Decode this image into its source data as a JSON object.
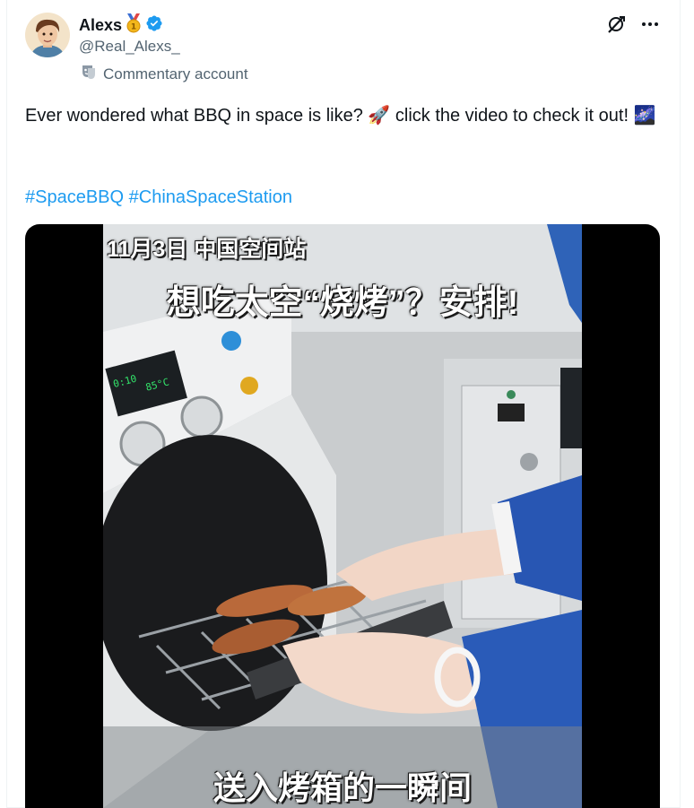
{
  "author": {
    "name": "Alexs",
    "handle": "@Real_Alexs_",
    "label": "Commentary account"
  },
  "post": {
    "text": "Ever wondered what BBQ in space is like? 🚀 click the video to check it out! 🌌",
    "hashtags": [
      "#SpaceBBQ",
      "#ChinaSpaceStation"
    ]
  },
  "video": {
    "caption_date": "11月3日 中国空间站",
    "caption_headline": "想吃太空“烧烤”？安排!",
    "caption_bottom": "送入烤箱的一瞬间",
    "oven_display_line1": "0:10",
    "oven_display_line2": "85°C"
  },
  "colors": {
    "accent": "#1d9bf0",
    "verified": "#1d9bf0",
    "muted": "#536471"
  },
  "icons": {
    "medal": "gold-medal-icon",
    "verified": "verified-badge-icon",
    "commentary": "mask-icon",
    "grok": "grok-icon",
    "more": "more-icon"
  }
}
